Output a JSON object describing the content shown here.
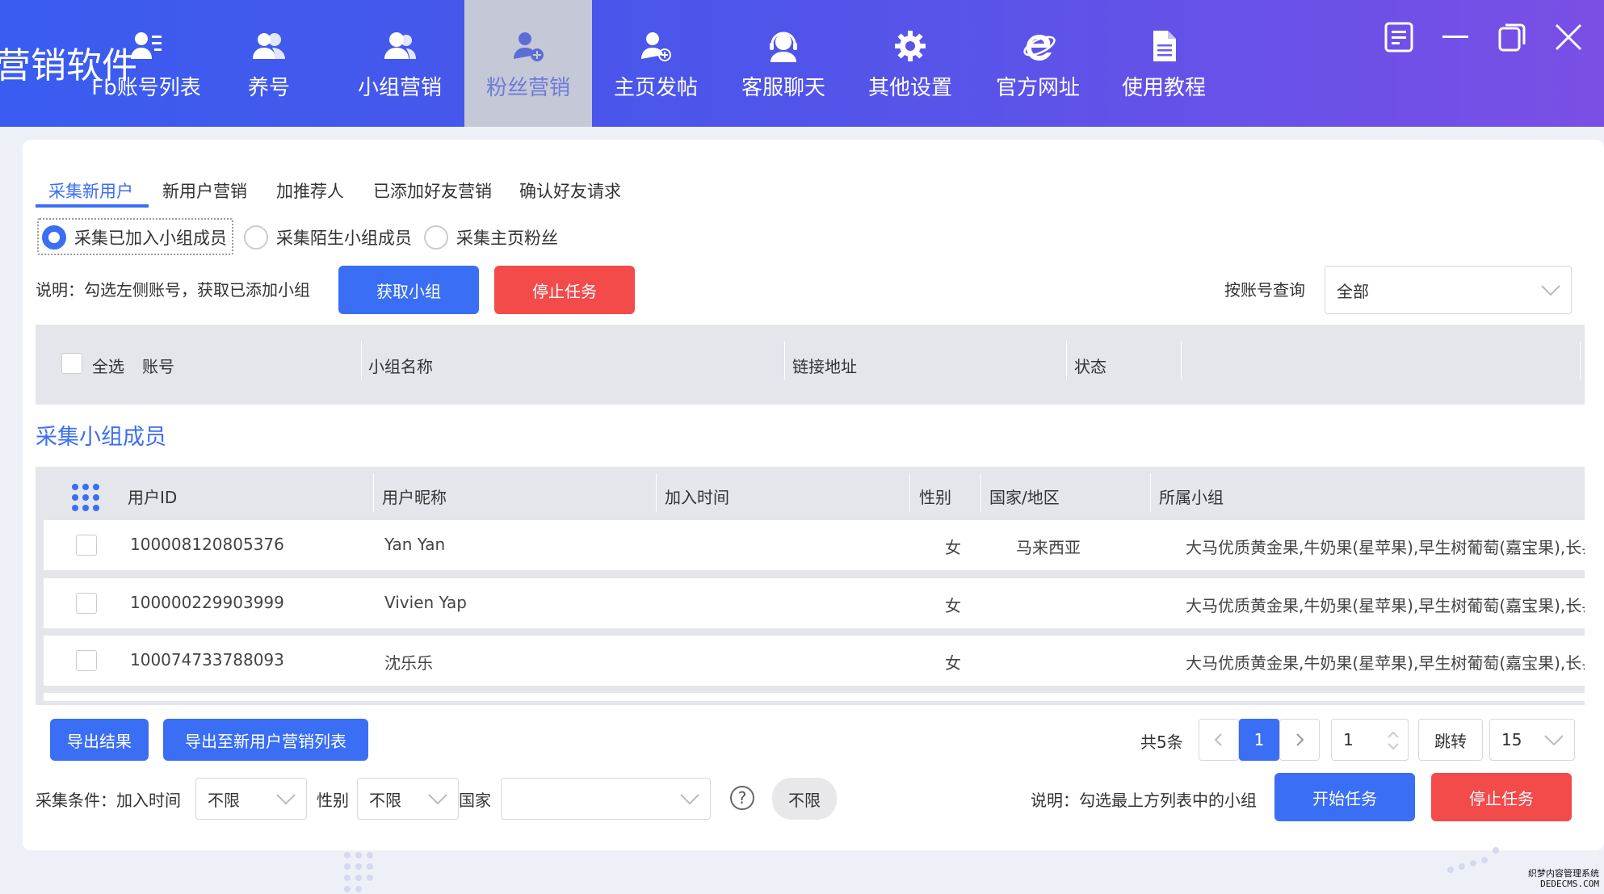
{
  "header": {
    "brand": "营销软件",
    "nav": [
      {
        "label": "Fb账号列表",
        "icon": "account-list-icon"
      },
      {
        "label": "养号",
        "icon": "users-icon"
      },
      {
        "label": "小组营销",
        "icon": "group-icon"
      },
      {
        "label": "粉丝营销",
        "icon": "add-user-icon",
        "active": true
      },
      {
        "label": "主页发帖",
        "icon": "user-plus-icon"
      },
      {
        "label": "客服聊天",
        "icon": "headset-icon"
      },
      {
        "label": "其他设置",
        "icon": "gear-icon"
      },
      {
        "label": "官方网址",
        "icon": "browser-icon"
      },
      {
        "label": "使用教程",
        "icon": "document-icon"
      }
    ],
    "window_controls": [
      "menu-icon",
      "minimize-icon",
      "restore-icon",
      "close-icon"
    ]
  },
  "tabs": [
    "采集新用户",
    "新用户营销",
    "加推荐人",
    "已添加好友营销",
    "确认好友请求"
  ],
  "active_tab": "采集新用户",
  "radios": [
    {
      "label": "采集已加入小组成员",
      "checked": true
    },
    {
      "label": "采集陌生小组成员",
      "checked": false
    },
    {
      "label": "采集主页粉丝",
      "checked": false
    }
  ],
  "toolbar": {
    "description": "说明：勾选左侧账号，获取已添加小组",
    "get_group_label": "获取小组",
    "stop_task_label": "停止任务",
    "account_query_label": "按账号查询",
    "account_query_value": "全部"
  },
  "group_table": {
    "select_all": "全选",
    "columns": [
      "账号",
      "小组名称",
      "链接地址",
      "状态"
    ]
  },
  "members": {
    "section_title": "采集小组成员",
    "columns": [
      "用户ID",
      "用户昵称",
      "加入时间",
      "性别",
      "国家/地区",
      "所属小组"
    ],
    "rows": [
      {
        "id": "100008120805376",
        "nickname": "Yan Yan",
        "join_time": "",
        "gender": "女",
        "country": "马来西亚",
        "group": "大马优质黄金果,牛奶果(星苹果),早生树葡萄(嘉宝果),长县"
      },
      {
        "id": "100000229903999",
        "nickname": "Vivien Yap",
        "join_time": "",
        "gender": "女",
        "country": "",
        "group": "大马优质黄金果,牛奶果(星苹果),早生树葡萄(嘉宝果),长县"
      },
      {
        "id": "100074733788093",
        "nickname": "沈乐乐",
        "join_time": "",
        "gender": "女",
        "country": "",
        "group": "大马优质黄金果,牛奶果(星苹果),早生树葡萄(嘉宝果),长县"
      }
    ]
  },
  "export": {
    "export_results": "导出结果",
    "export_to_marketing": "导出至新用户营销列表"
  },
  "pagination": {
    "total": "共5条",
    "current_page": "1",
    "page_input": "1",
    "jump": "跳转",
    "page_size": "15"
  },
  "conditions": {
    "label": "采集条件：加入时间",
    "join_time_value": "不限",
    "gender_label": "性别",
    "gender_value": "不限",
    "country_label": "国家",
    "country_value": "",
    "help": "?",
    "unlimited_chip": "不限",
    "description": "说明：勾选最上方列表中的小组",
    "start_label": "开始任务",
    "stop_label": "停止任务"
  },
  "watermark": {
    "line1": "织梦内容管理系统",
    "line2": "DEDECMS.COM"
  },
  "colors": {
    "accent": "#3a6ef5",
    "danger": "#f34a4a",
    "header_start": "#3a5cf0",
    "header_end": "#7a4fe6"
  }
}
